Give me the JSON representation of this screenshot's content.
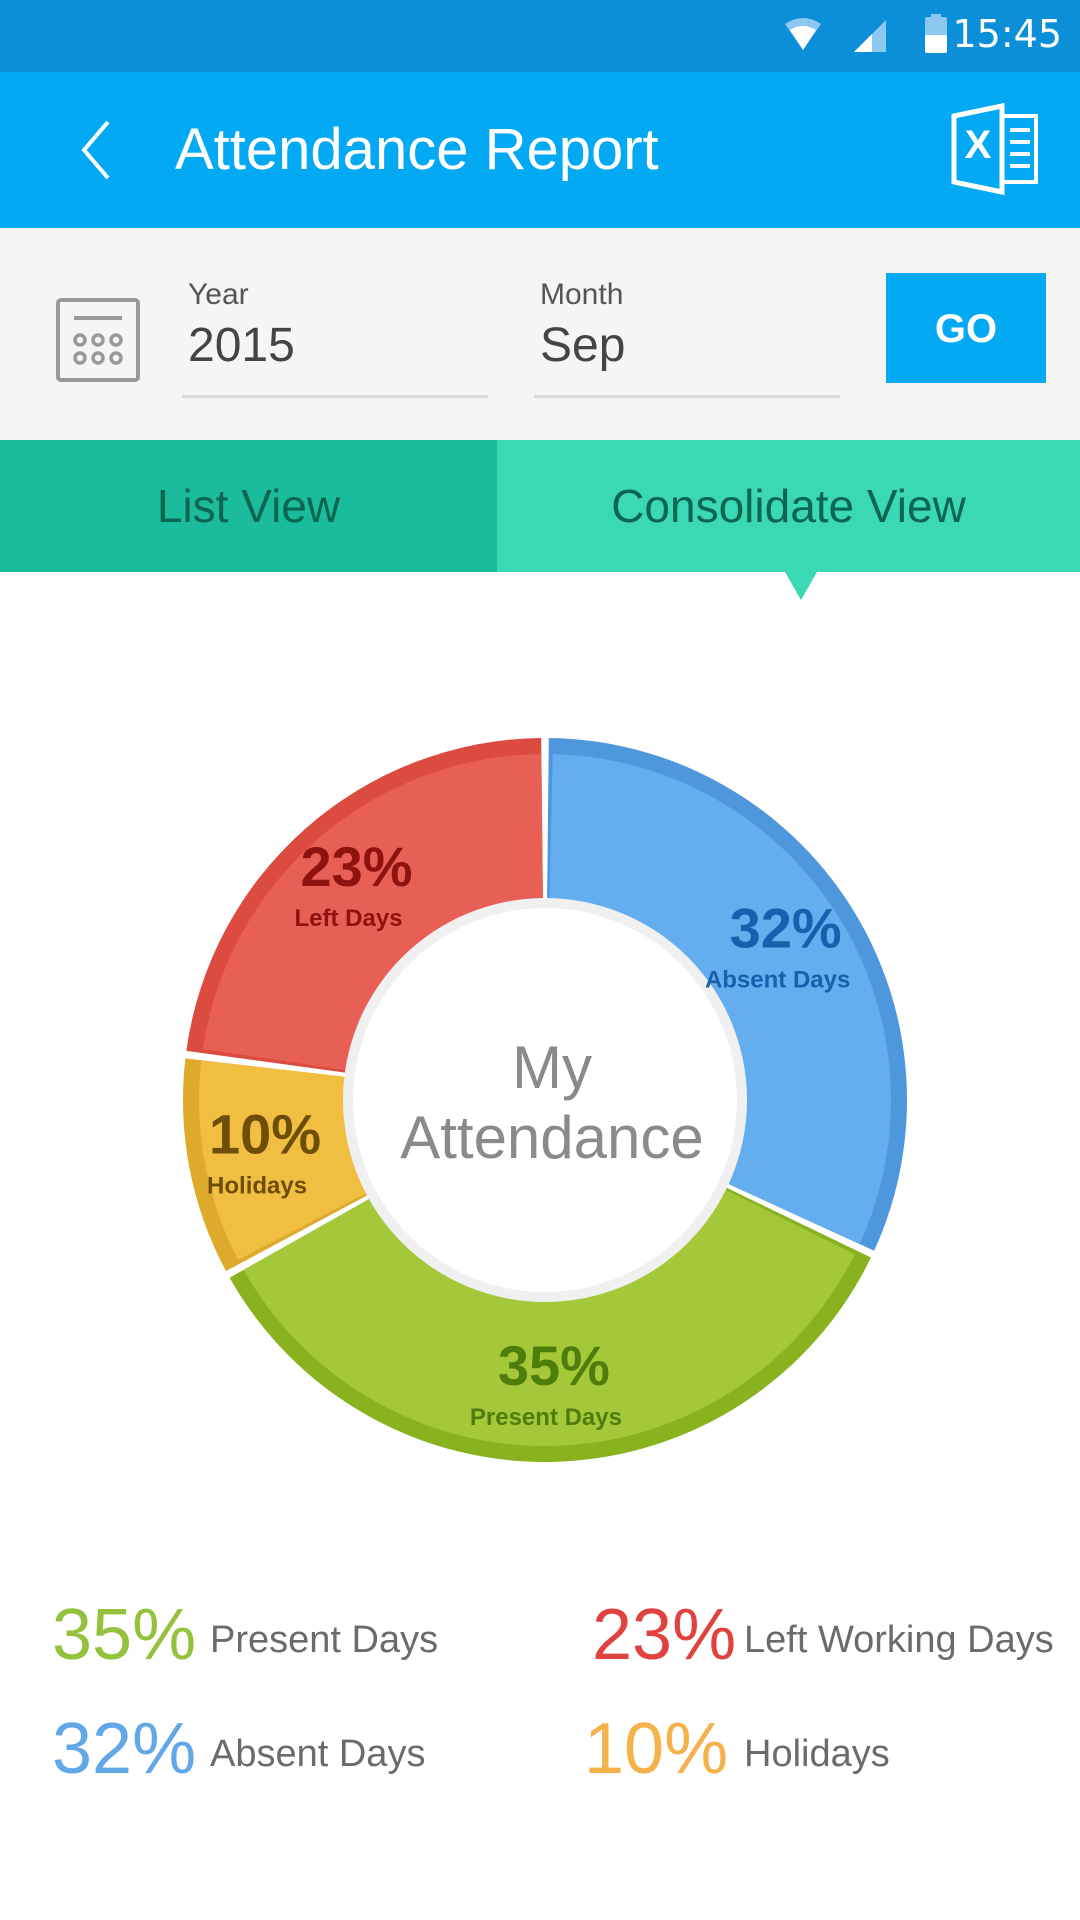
{
  "status_bar": {
    "time": "15:45",
    "icons": [
      "wifi-icon",
      "cell-signal-icon",
      "battery-icon"
    ]
  },
  "app_bar": {
    "title": "Attendance Report",
    "back_icon": "chevron-left-icon",
    "export_icon": "excel-icon"
  },
  "filters": {
    "year": {
      "label": "Year",
      "value": "2015"
    },
    "month": {
      "label": "Month",
      "value": "Sep"
    },
    "go_label": "GO",
    "calendar_icon": "calendar-icon"
  },
  "tabs": [
    {
      "label": "List View",
      "active": false
    },
    {
      "label": "Consolidate View",
      "active": true
    }
  ],
  "colors": {
    "status_bar": "#0a8fd8",
    "app_bar": "#04a9f4",
    "tab_list": "#1abc9c",
    "tab_consolidate": "#3bd8b6"
  },
  "chart_data": {
    "type": "pie",
    "title": "My Attendance",
    "center_label": [
      "My",
      "Attendance"
    ],
    "donut": true,
    "slices": [
      {
        "key": "absent",
        "label": "Absent Days",
        "value": 32,
        "display": "32%",
        "color": "#64adef",
        "edge": "#4f97dd",
        "text": "#1a5fae"
      },
      {
        "key": "present",
        "label": "Present Days",
        "value": 35,
        "display": "35%",
        "color": "#a5c83a",
        "edge": "#88b31f",
        "text": "#4f7d0c"
      },
      {
        "key": "holidays",
        "label": "Holidays",
        "value": 10,
        "display": "10%",
        "color": "#f0bf42",
        "edge": "#ddaa2b",
        "text": "#6e4e06"
      },
      {
        "key": "left",
        "label": "Left Days",
        "value": 23,
        "display": "23%",
        "color": "#e85f55",
        "edge": "#dc4b40",
        "text": "#8e1210"
      }
    ]
  },
  "legend": [
    {
      "value": "35%",
      "label": "Present Days",
      "color": "#95c23d"
    },
    {
      "value": "23%",
      "label": "Left Working Days",
      "color": "#e0433f"
    },
    {
      "value": "32%",
      "label": "Absent Days",
      "color": "#62a8e8"
    },
    {
      "value": "10%",
      "label": "Holidays",
      "color": "#f5b24a"
    }
  ]
}
